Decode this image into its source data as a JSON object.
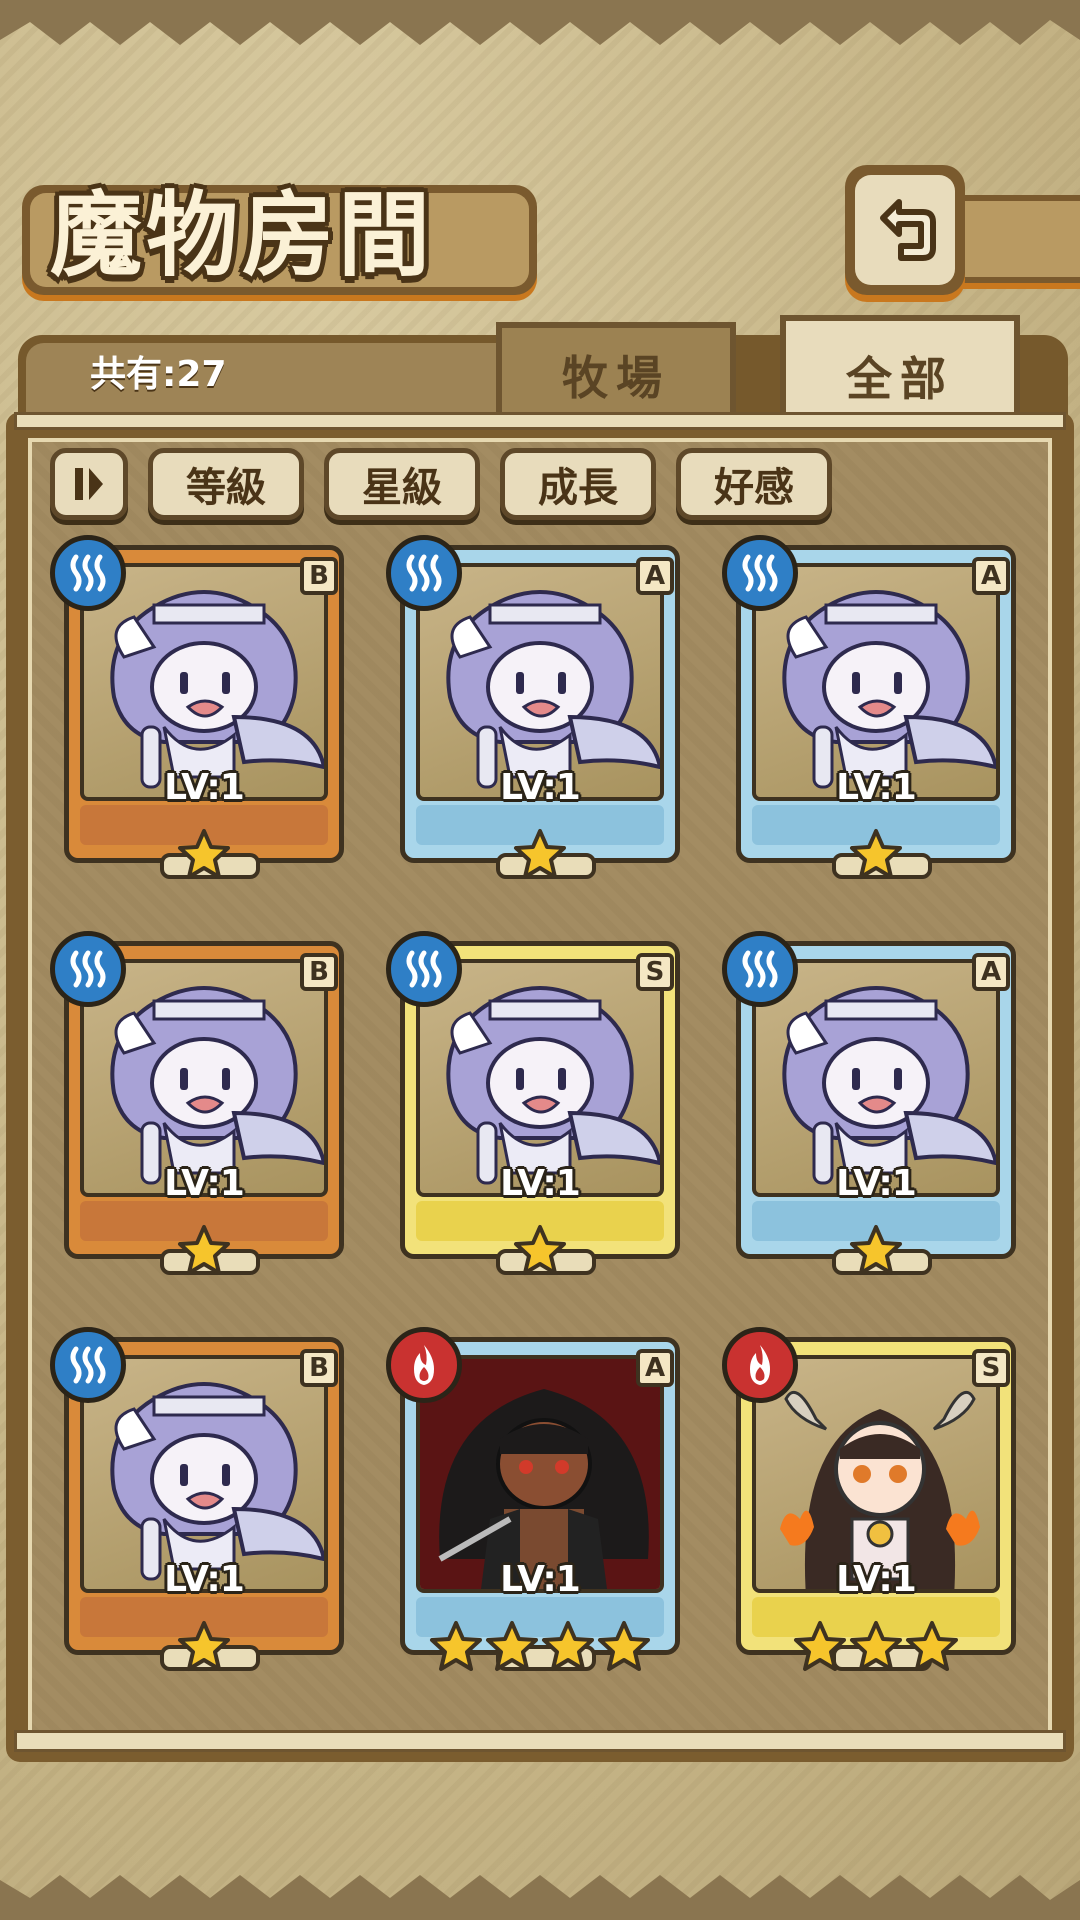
{
  "header": {
    "title": "魔物房間",
    "back_icon": "back-return-icon"
  },
  "tabs": [
    {
      "label": "牧場",
      "selected": false
    },
    {
      "label": "全部",
      "selected": true
    }
  ],
  "summary": {
    "count_label": "共有:27"
  },
  "filters": {
    "sort_icon": "sort-order-icon",
    "buttons": [
      "等級",
      "星級",
      "成長",
      "好感"
    ]
  },
  "monsters": [
    {
      "rank": "B",
      "element": "water",
      "level": "LV:1",
      "stars": 1,
      "portrait": "harpy-girl"
    },
    {
      "rank": "A",
      "element": "water",
      "level": "LV:1",
      "stars": 1,
      "portrait": "harpy-girl"
    },
    {
      "rank": "A",
      "element": "water",
      "level": "LV:1",
      "stars": 1,
      "portrait": "harpy-girl"
    },
    {
      "rank": "B",
      "element": "water",
      "level": "LV:1",
      "stars": 1,
      "portrait": "harpy-girl"
    },
    {
      "rank": "S",
      "element": "water",
      "level": "LV:1",
      "stars": 1,
      "portrait": "harpy-girl"
    },
    {
      "rank": "A",
      "element": "water",
      "level": "LV:1",
      "stars": 1,
      "portrait": "harpy-girl"
    },
    {
      "rank": "B",
      "element": "water",
      "level": "LV:1",
      "stars": 1,
      "portrait": "harpy-girl"
    },
    {
      "rank": "A",
      "element": "fire",
      "level": "LV:1",
      "stars": 4,
      "portrait": "dark-warrior-girl"
    },
    {
      "rank": "S",
      "element": "fire",
      "level": "LV:1",
      "stars": 3,
      "portrait": "horned-fire-girl"
    }
  ],
  "colors": {
    "water": "#2f7fc6",
    "fire": "#c93230",
    "rank_B": "#d98a3a",
    "rank_A": "#a9d6ea",
    "rank_S": "#f2e27a",
    "star": "#f6c52c"
  }
}
